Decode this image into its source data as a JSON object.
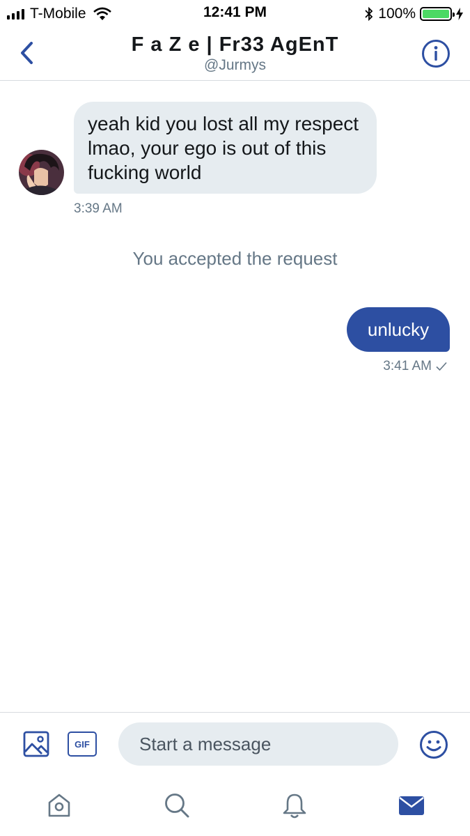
{
  "status_bar": {
    "carrier": "T-Mobile",
    "time": "12:41 PM",
    "battery_percent": "100%",
    "battery_level": 1.0,
    "icons": [
      "signal-icon",
      "wifi-icon",
      "bluetooth-icon",
      "battery-icon",
      "charging-icon"
    ]
  },
  "header": {
    "title": "F a Z e | Fr33 AgEnT",
    "handle": "@Jurmys",
    "icons": [
      "back-chevron-icon",
      "info-icon"
    ]
  },
  "conversation": {
    "incoming": {
      "text": "yeah kid you lost all my respect lmao, your ego is out of this fucking world",
      "time": "3:39 AM"
    },
    "system_message": "You accepted the request",
    "outgoing": {
      "text": "unlucky",
      "time": "3:41 AM"
    }
  },
  "compose": {
    "placeholder": "Start a message",
    "gif_label": "GIF",
    "icons": [
      "image-icon",
      "gif-icon",
      "emoji-icon"
    ]
  },
  "tab_bar": {
    "icons": [
      "home-icon",
      "search-icon",
      "notifications-icon",
      "messages-icon"
    ],
    "active": "messages-icon"
  },
  "colors": {
    "accent": "#2d4fa2",
    "bubble_incoming": "#e6ecf0",
    "secondary_text": "#657786",
    "battery": "#4cd964"
  }
}
